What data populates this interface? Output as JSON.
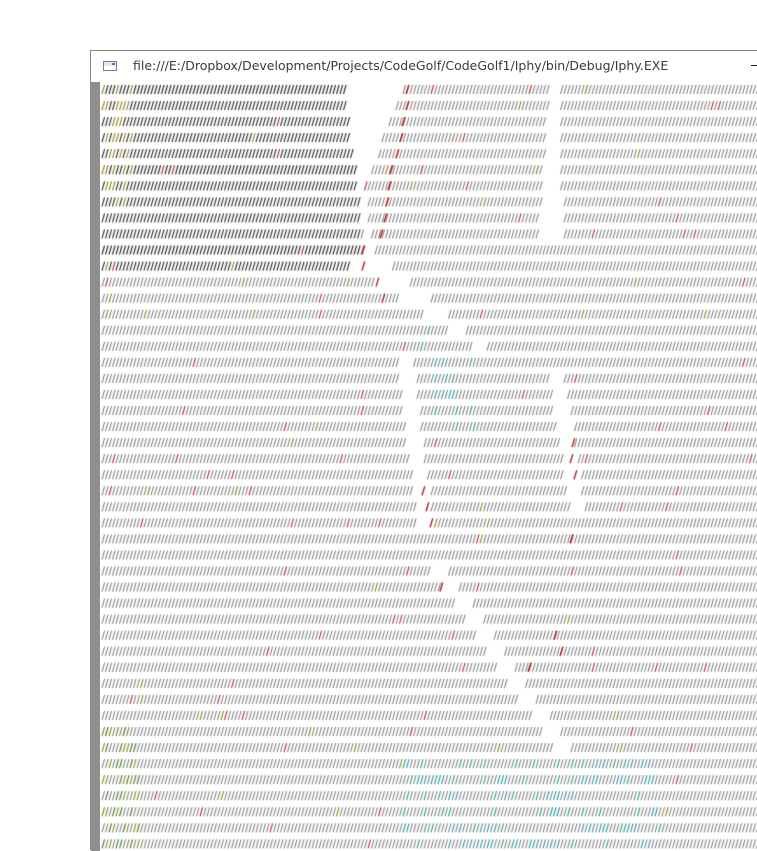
{
  "window": {
    "title": "file:///E:/Dropbox/Development/Projects/CodeGolf/CodeGolf1/Iphy/bin/Debug/Iphy.EXE",
    "app_icon": "console-app-icon",
    "controls": [
      "minimize-icon"
    ]
  },
  "console": {
    "glyph": "/",
    "background": "#ffffff",
    "colors": {
      "base": "#1c1c1c",
      "red": "#b21b1b",
      "olive": "#8a7a10",
      "green": "#2e6b1f",
      "teal": "#1a8f98"
    }
  }
}
